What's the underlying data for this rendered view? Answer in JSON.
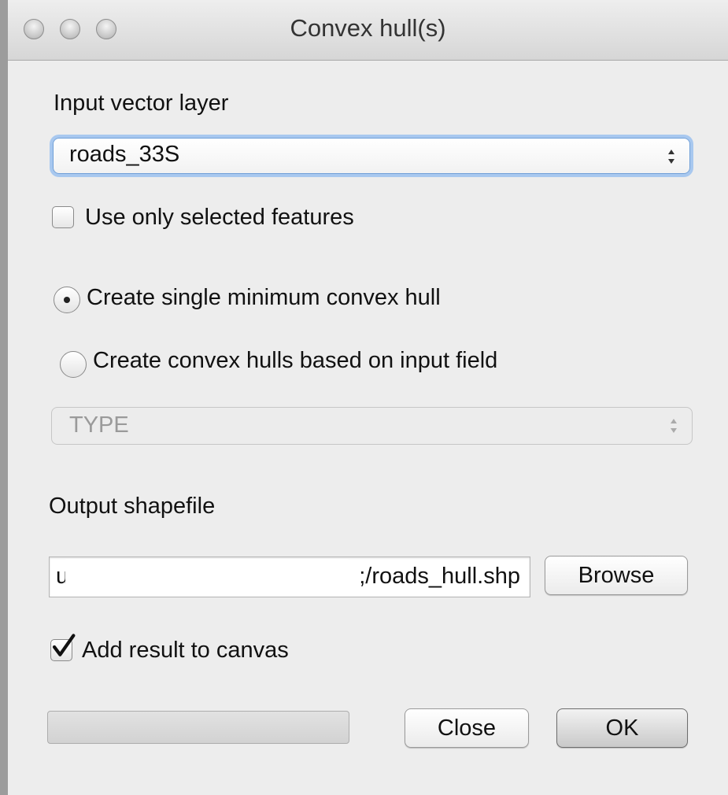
{
  "window": {
    "title": "Convex hull(s)"
  },
  "input_layer": {
    "label": "Input vector layer",
    "selected": "roads_33S"
  },
  "selected_features": {
    "label": "Use only selected features",
    "checked": false
  },
  "hull_options": {
    "single_label": "Create single minimum convex hull",
    "field_label": "Create convex hulls based on input field",
    "selected": "single"
  },
  "field_select": {
    "selected": "TYPE",
    "enabled": false
  },
  "output": {
    "label": "Output shapefile",
    "path_lead": "u",
    "path_tail": ";/roads_hull.shp",
    "browse_label": "Browse"
  },
  "add_to_canvas": {
    "label": "Add result to canvas",
    "checked": true
  },
  "progress": {
    "value": 0
  },
  "buttons": {
    "close_label": "Close",
    "ok_label": "OK"
  }
}
